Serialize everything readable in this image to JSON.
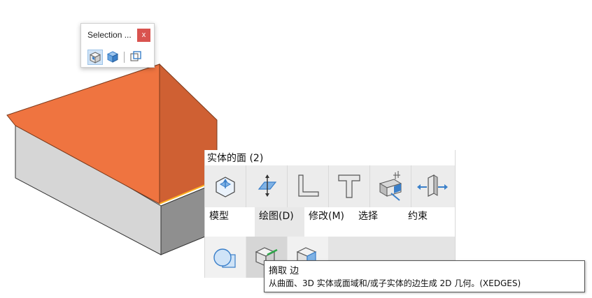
{
  "selection_panel": {
    "title": "Selection ...",
    "close_label": "x",
    "buttons": [
      "select-solid-icon",
      "select-face-icon",
      "select-edge-icon"
    ]
  },
  "quad": {
    "header": "实体的面 (2)",
    "tabs": [
      {
        "label": "模型",
        "icon": "model-icon"
      },
      {
        "label": "绘图(D)",
        "icon": "draw-icon"
      },
      {
        "label": "修改(M)",
        "icon": "modify-icon"
      },
      {
        "label": "选择",
        "icon": "select-icon"
      },
      {
        "label": "约束",
        "icon": "constraint-icon"
      }
    ],
    "tools": [
      "circle-tool-icon",
      "extract-edges-icon",
      "extract-faces-icon"
    ]
  },
  "tooltip": {
    "title": "摘取 边",
    "description": "从曲面、3D 实体或面域和/或子实体的边生成 2D 几何。(XEDGES)"
  },
  "colors": {
    "roof": "#ee7440",
    "roof_shadow": "#cc5e32",
    "wall_front": "#a8a8a8",
    "wall_side": "#d9d9d9",
    "close": "#d9534f",
    "icon_blue": "#3a7fc9"
  }
}
